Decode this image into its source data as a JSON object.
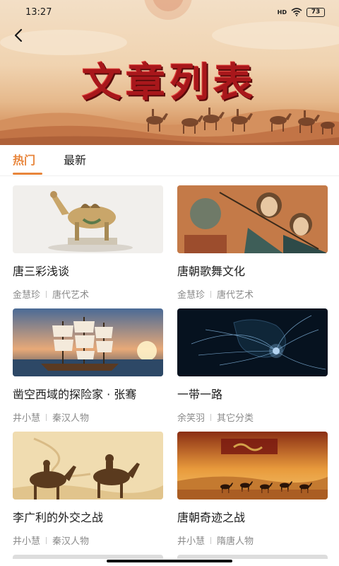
{
  "status_bar": {
    "time": "13:27",
    "network": "HD",
    "battery": "73"
  },
  "header": {
    "title": "文章列表"
  },
  "tabs": [
    {
      "label": "热门",
      "active": true
    },
    {
      "label": "最新",
      "active": false
    }
  ],
  "articles": [
    {
      "title": "唐三彩浅谈",
      "author": "金慧珍",
      "category": "唐代艺术",
      "image": "tang-sancai-camel"
    },
    {
      "title": "唐朝歌舞文化",
      "author": "金慧珍",
      "category": "唐代艺术",
      "image": "dunhuang-mural-musicians"
    },
    {
      "title": "凿空西域的探险家 · 张骞",
      "author": "井小慧",
      "category": "秦汉人物",
      "image": "sailing-ship-sunset"
    },
    {
      "title": "一带一路",
      "author": "余笑羽",
      "category": "其它分类",
      "image": "network-map"
    },
    {
      "title": "李广利的外交之战",
      "author": "井小慧",
      "category": "秦汉人物",
      "image": "camel-caravan-silhouette"
    },
    {
      "title": "唐朝奇迹之战",
      "author": "井小慧",
      "category": "隋唐人物",
      "image": "silk-road-caravan-sunset"
    }
  ],
  "colors": {
    "accent": "#e8853b",
    "title_red": "#a8171b",
    "meta_gray": "#8a8a8a"
  },
  "icons": {
    "back": "chevron-left-icon",
    "wifi": "wifi-icon",
    "battery": "battery-icon"
  }
}
